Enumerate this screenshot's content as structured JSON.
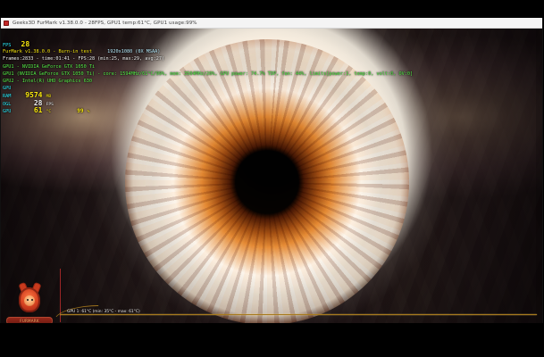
{
  "window": {
    "title": "Geeks3D FurMark v1.38.0.0 - 28FPS, GPU1 temp:61°C, GPU1 usage:99%"
  },
  "hud": {
    "rows": [
      {
        "label": "FPS",
        "value": "28",
        "unit": ""
      },
      {
        "label": "FurMark v1.38.0.0 - Burn-in test",
        "value": "",
        "unit": "1920x1080 (0X MSAA)"
      },
      {
        "label": "Frames:2833 - time:01:41 - FPS:28 (min:25, max:29, avg:27)",
        "value": "",
        "unit": ""
      },
      {
        "label": "GPU1 - NVIDIA GeForce GTX 1050 Ti",
        "value": "",
        "unit": ""
      },
      {
        "label": "GPU1 (NVIDIA GeForce GTX 1050 Ti) - core: 1594MHz/61°C/99%, mem: 3504MHz/20%, GPU power: 74.7% TDP, fan: 44%, limits[power:1, temp:0, volt:0, OV:0]",
        "value": "",
        "unit": ""
      },
      {
        "label": "GPU2 - Intel(R) UHD Graphics 630",
        "value": "",
        "unit": ""
      },
      {
        "label": "GPU",
        "value": "",
        "unit": ""
      },
      {
        "label": "RAM",
        "value": "9574",
        "unit": "MB"
      },
      {
        "label": "OGL",
        "value": "28",
        "unit": "FPS"
      },
      {
        "label": "GPU",
        "value": "61",
        "unit": "°C",
        "extra": "99",
        "extra_unit": "%"
      }
    ]
  },
  "graph": {
    "label": "GPU 1: 61°C (min: 35°C - max: 61°C)"
  },
  "logo": {
    "text": "FURMARK"
  },
  "colors": {
    "hud_cyan": "#2df0ff",
    "hud_yellow": "#fbe90f",
    "hud_orange": "#ff9f23",
    "hud_green": "#5bf34c",
    "graph_line": "#a77a1e"
  }
}
